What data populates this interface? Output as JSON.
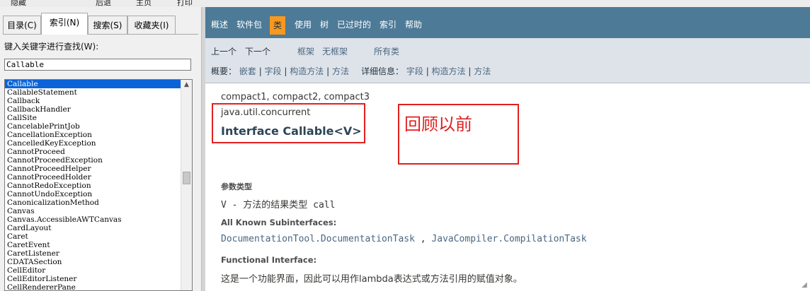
{
  "toolbar": {
    "items": [
      "隐藏",
      "后退",
      "主页",
      "打印"
    ]
  },
  "left_pane": {
    "tabs": [
      {
        "label": "目录(C)",
        "active": false
      },
      {
        "label": "索引(N)",
        "active": true
      },
      {
        "label": "搜索(S)",
        "active": false
      },
      {
        "label": "收藏夹(I)",
        "active": false
      }
    ],
    "keyword_label": "键入关键字进行查找(W):",
    "keyword_value": "Callable",
    "index_items": [
      "Callable",
      "CallableStatement",
      "Callback",
      "CallbackHandler",
      "CallSite",
      "CancelablePrintJob",
      "CancellationException",
      "CancelledKeyException",
      "CannotProceed",
      "CannotProceedException",
      "CannotProceedHelper",
      "CannotProceedHolder",
      "CannotRedoException",
      "CannotUndoException",
      "CanonicalizationMethod",
      "Canvas",
      "Canvas.AccessibleAWTCanvas",
      "CardLayout",
      "Caret",
      "CaretEvent",
      "CaretListener",
      "CDATASection",
      "CellEditor",
      "CellEditorListener",
      "CellRendererPane"
    ],
    "selected_index": 0
  },
  "nav": {
    "items": [
      {
        "label": "概述",
        "active": false
      },
      {
        "label": "软件包",
        "active": false
      },
      {
        "label": "类",
        "active": true
      },
      {
        "label": "使用",
        "active": false
      },
      {
        "label": "树",
        "active": false
      },
      {
        "label": "已过时的",
        "active": false
      },
      {
        "label": "索引",
        "active": false
      },
      {
        "label": "帮助",
        "active": false
      }
    ],
    "accent_color": "#f8981d",
    "bar_color": "#4d7a97"
  },
  "subnav": {
    "prev": "上一个",
    "next": "下一个",
    "frames": "框架",
    "no_frames": "无框架",
    "all_classes": "所有类",
    "summary_label": "概要：",
    "summary_links": [
      "嵌套",
      "字段",
      "构造方法",
      "方法"
    ],
    "detail_label": "详细信息：",
    "detail_links": [
      "字段",
      "构造方法",
      "方法"
    ]
  },
  "doc": {
    "compact": "compact1, compact2, compact3",
    "package": "java.util.concurrent",
    "title": "Interface Callable<V>",
    "annotation": "回顾以前",
    "param_heading": "参数类型",
    "param_desc": "V - 方法的结果类型 call",
    "subinterfaces_heading": "All Known Subinterfaces:",
    "subinterfaces": [
      "DocumentationTool.DocumentationTask",
      "JavaCompiler.CompilationTask"
    ],
    "subinterfaces_sep": " , ",
    "functional_heading": "Functional Interface:",
    "functional_desc": "这是一个功能界面，因此可以用作lambda表达式或方法引用的赋值对象。"
  },
  "colors": {
    "highlight": "#e02020",
    "selection": "#0a64d8"
  }
}
